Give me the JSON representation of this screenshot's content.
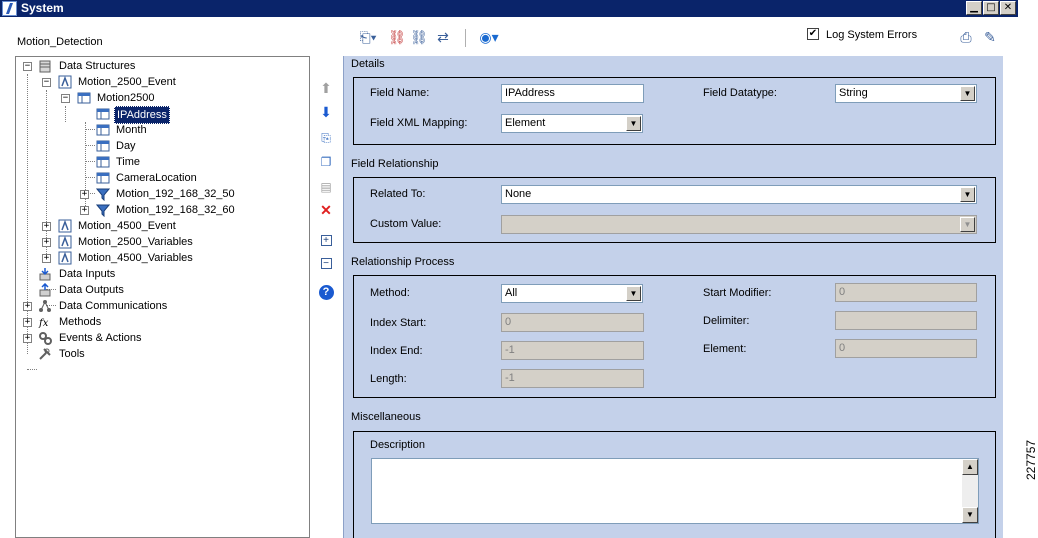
{
  "window": {
    "title": "System"
  },
  "tree": {
    "title": "Motion_Detection",
    "nodes": [
      {
        "label": "Data Structures"
      },
      {
        "label": "Motion_2500_Event"
      },
      {
        "label": "Motion2500"
      },
      {
        "label": "IPAddress"
      },
      {
        "label": "Month"
      },
      {
        "label": "Day"
      },
      {
        "label": "Time"
      },
      {
        "label": "CameraLocation"
      },
      {
        "label": "Motion_192_168_32_50"
      },
      {
        "label": "Motion_192_168_32_60"
      },
      {
        "label": "Motion_4500_Event"
      },
      {
        "label": "Motion_2500_Variables"
      },
      {
        "label": "Motion_4500_Variables"
      },
      {
        "label": "Data Inputs"
      },
      {
        "label": "Data Outputs"
      },
      {
        "label": "Data Communications"
      },
      {
        "label": "Methods"
      },
      {
        "label": "Events & Actions"
      },
      {
        "label": "Tools"
      }
    ]
  },
  "toolbar": {
    "log_errors_label": "Log System Errors",
    "log_errors_checked": true
  },
  "details": {
    "title": "Details",
    "field_name_label": "Field Name:",
    "field_name_value": "IPAddress",
    "field_datatype_label": "Field Datatype:",
    "field_datatype_value": "String",
    "xml_mapping_label": "Field XML Mapping:",
    "xml_mapping_value": "Element"
  },
  "relationship": {
    "title": "Field Relationship",
    "related_to_label": "Related To:",
    "related_to_value": "None",
    "custom_value_label": "Custom Value:",
    "custom_value_value": ""
  },
  "process": {
    "title": "Relationship Process",
    "method_label": "Method:",
    "method_value": "All",
    "index_start_label": "Index Start:",
    "index_start_value": "0",
    "index_end_label": "Index End:",
    "index_end_value": "-1",
    "length_label": "Length:",
    "length_value": "-1",
    "start_modifier_label": "Start Modifier:",
    "start_modifier_value": "0",
    "delimiter_label": "Delimiter:",
    "delimiter_value": "",
    "element_label": "Element:",
    "element_value": "0"
  },
  "misc": {
    "title": "Miscellaneous",
    "description_label": "Description",
    "description_value": ""
  },
  "figure_number": "227757",
  "colors": {
    "titlebar": "#0a246a",
    "panel": "#c4d1ea",
    "selection": "#0a246a",
    "delete_red": "#e02020",
    "arrow_blue": "#1a5ad0"
  }
}
